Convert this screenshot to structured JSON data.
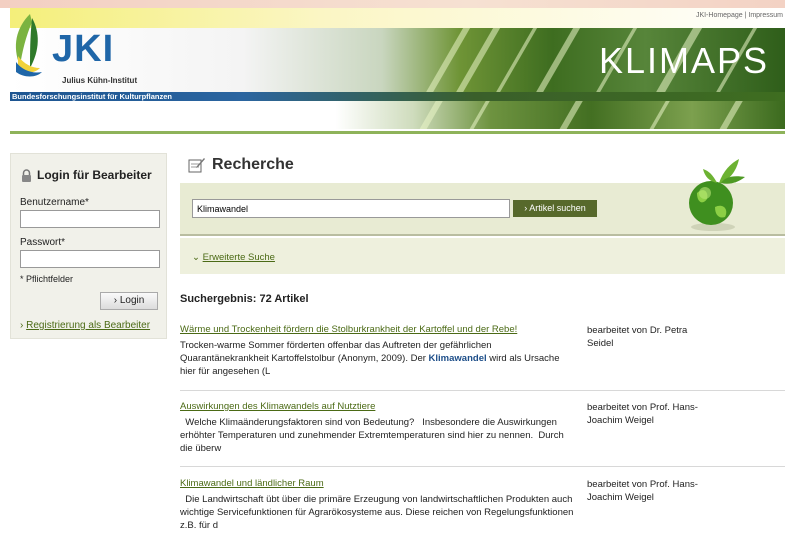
{
  "header": {
    "links": [
      "JKI-Homepage",
      "Impressum"
    ],
    "link_separator": "|",
    "logo_text": "JKI",
    "logo_subtitle": "Julius Kühn-Institut",
    "institute": "Bundesforschungsinstitut für Kulturpflanzen",
    "app_name": "KLIMAPS"
  },
  "login": {
    "title": "Login für Bearbeiter",
    "username_label": "Benutzername*",
    "password_label": "Passwort*",
    "required_note": "* Pflichtfelder",
    "login_button": "Login",
    "register_link": "Registrierung als Bearbeiter"
  },
  "search": {
    "title": "Recherche",
    "query": "Klimawandel",
    "button": "Artikel suchen",
    "advanced": "Erweiterte Suche",
    "result_count": "Suchergebnis: 72 Artikel"
  },
  "results": [
    {
      "title": "Wärme und Trockenheit fördern die Stolburkrankheit der Kartoffel und der Rebe!",
      "desc_before": "Trocken-warme Sommer förderten offenbar das Auftreten der gefährlichen Quarantänekrankheit Kartoffelstolbur (Anonym, 2009). Der ",
      "desc_highlight": "Klimawandel",
      "desc_after": " wird als Ursache hier für angesehen (L",
      "author": "bearbeitet von Dr. Petra Seidel"
    },
    {
      "title": "Auswirkungen des Klimawandels auf Nutztiere",
      "desc_before": "  Welche Klimaänderungsfaktoren sind von Bedeutung?   Insbesondere die Auswirkungen erhöhter Temperaturen und zunehmender Extremtemperaturen sind hier zu nennen.  Durch die überw",
      "desc_highlight": "",
      "desc_after": "",
      "author": "bearbeitet von Prof. Hans-Joachim Weigel"
    },
    {
      "title": "Klimawandel und ländlicher Raum",
      "desc_before": "  Die Landwirtschaft übt über die primäre Erzeugung von landwirtschaftlichen Produkten auch wichtige Servicefunktionen für Agrarökosysteme aus. Diese reichen von Regelungsfunktionen z.B. für d",
      "desc_highlight": "",
      "desc_after": "",
      "author": "bearbeitet von Prof. Hans-Joachim Weigel"
    }
  ],
  "icons": {
    "logo": "wheat-leaf-logo-icon",
    "lock": "lock-icon",
    "notepad": "notepad-pencil-icon",
    "globe": "green-globe-icon",
    "arrow": "chevron-right-icon",
    "expand": "chevron-down-icon"
  },
  "colors": {
    "link_green": "#4b6a15",
    "button_green": "#57692b",
    "highlight_blue": "#1d4e89",
    "search_bg": "#e8ebd3"
  }
}
